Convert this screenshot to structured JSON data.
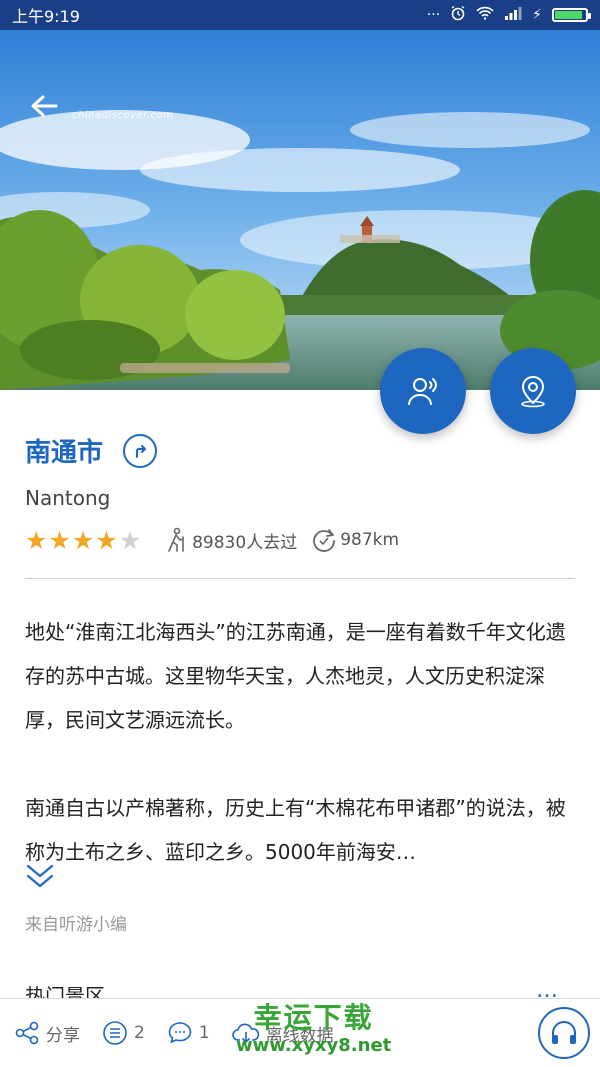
{
  "status_bar": {
    "time": "上午9:19",
    "battery_level": 0.9
  },
  "hero": {
    "watermark": "chinadiscover.com"
  },
  "fab": {
    "guide_icon": "audio-guide-person-icon",
    "location_icon": "location-pin-icon"
  },
  "city": {
    "name": "南通市",
    "english_name": "Nantong",
    "rating": 4,
    "rating_max": 5,
    "visitors": "89830人去过",
    "distance": "987km"
  },
  "description": {
    "paragraph1": "地处“淮南江北海西头”的江苏南通，是一座有着数千年文化遗存的苏中古城。这里物华天宝，人杰地灵，人文历史积淀深厚，民间文艺源远流长。",
    "paragraph2": "南通自古以产棉著称，历史上有“木棉花布甲诸郡”的说法，被称为土布之乡、蓝印之乡。5000年前海安…",
    "source": "来自听游小编"
  },
  "section": {
    "title": "热门景区",
    "more": "…"
  },
  "bottom_bar": {
    "share_label": "分享",
    "list_count": "2",
    "comment_count": "1",
    "offline_label": "离线数据"
  },
  "watermark": {
    "cn": "幸运下载",
    "url": "www.xyxy8.net"
  },
  "colors": {
    "accent": "#1e67c0",
    "status_bar": "#1a3f86",
    "star_filled": "#f5a623",
    "star_empty": "#d0d0d0"
  }
}
